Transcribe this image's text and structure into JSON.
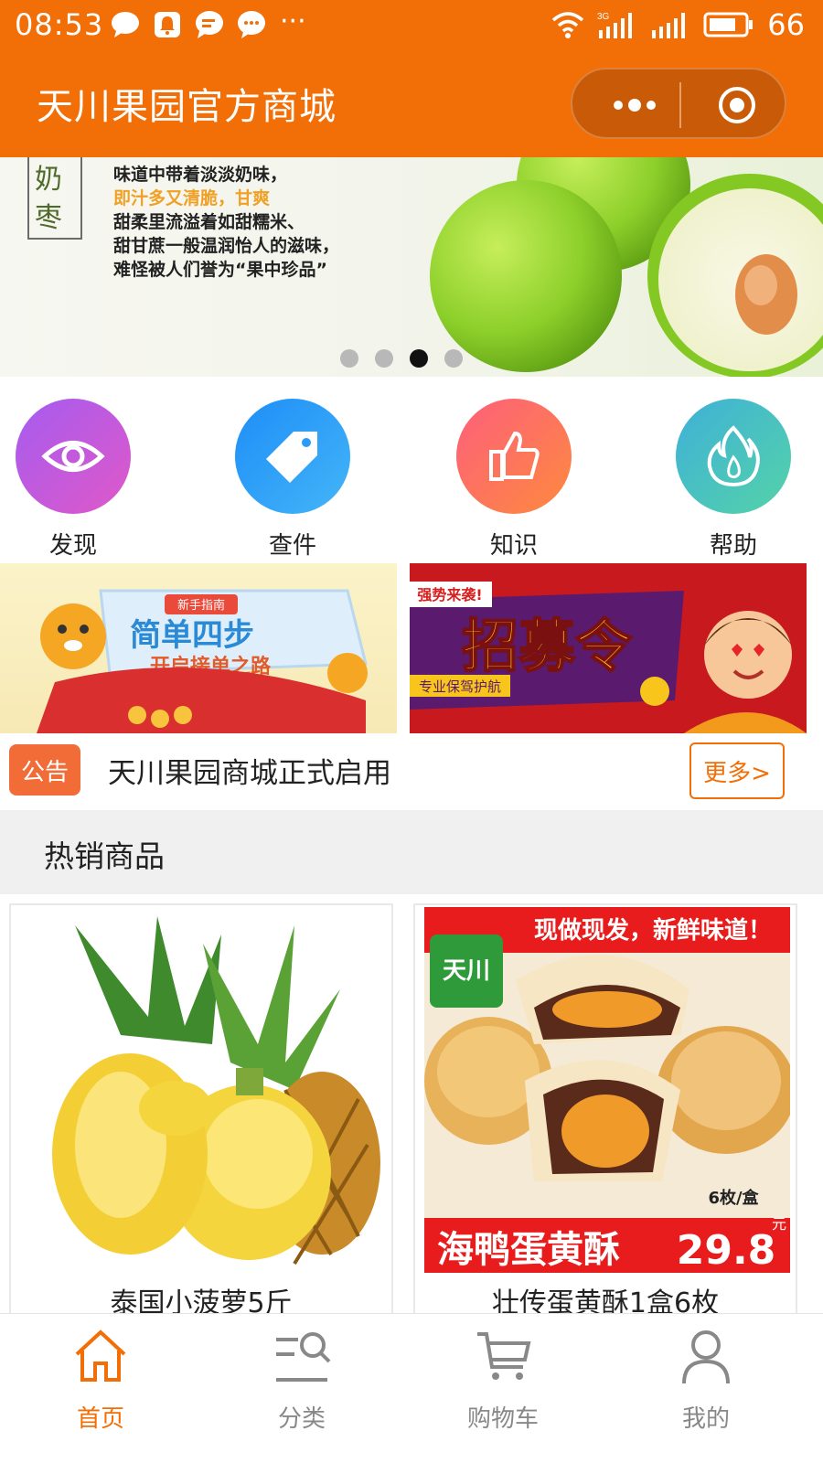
{
  "status_bar": {
    "time": "08:53",
    "battery": "66",
    "network": "3G"
  },
  "header": {
    "title": "天川果园官方商城",
    "colors": {
      "primary": "#f26f07",
      "capsule": "#c95a08"
    }
  },
  "banner": {
    "lines": [
      "味道中带着淡淡奶味，",
      "即汁多又清脆，甘爽",
      "甜柔里流溢着如甜糯米、",
      "甜甘蔗一般温润怡人的滋味，",
      "难怪被人们誉为“果中珍品”"
    ],
    "stamp_text": "奶枣",
    "slide_count": 4,
    "active_slide": 3
  },
  "quick_menu": [
    {
      "label": "发现",
      "icon": "eye-icon",
      "colors": [
        "#a55cf0",
        "#e058c8"
      ]
    },
    {
      "label": "查件",
      "icon": "tag-icon",
      "colors": [
        "#1d8ef7",
        "#44b5f7"
      ]
    },
    {
      "label": "知识",
      "icon": "thumbs-up-icon",
      "colors": [
        "#fd5f7c",
        "#fd8a3e"
      ]
    },
    {
      "label": "帮助",
      "icon": "flame-icon",
      "colors": [
        "#3fb0d8",
        "#54d3a8"
      ]
    }
  ],
  "promos": {
    "left": {
      "badge": "新手指南",
      "title": "简单四步",
      "subtitle": "开启接单之路"
    },
    "right": {
      "tag": "强势来袭!",
      "title": "招募令",
      "subtitle": "专业保驾护航"
    }
  },
  "notice": {
    "tag": "公告",
    "text": "天川果园商城正式启用",
    "more": "更多>"
  },
  "section": {
    "title": "热销商品"
  },
  "products": [
    {
      "name": "泰国小菠萝5斤"
    },
    {
      "name": "壮传蛋黄酥1盒6枚",
      "headline": "现做现发，新鲜味道！",
      "brand": "天川",
      "label": "海鸭蛋黄酥",
      "count": "6枚/盒",
      "price": "29.8",
      "unit": "元"
    }
  ],
  "tabbar": [
    {
      "label": "首页",
      "icon": "home-icon",
      "active": true
    },
    {
      "label": "分类",
      "icon": "category-search-icon",
      "active": false
    },
    {
      "label": "购物车",
      "icon": "cart-icon",
      "active": false
    },
    {
      "label": "我的",
      "icon": "user-icon",
      "active": false
    }
  ]
}
